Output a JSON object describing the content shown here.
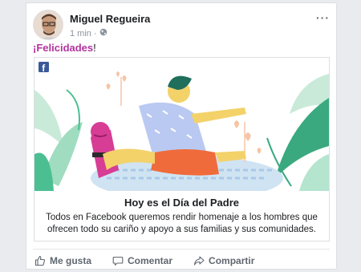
{
  "post": {
    "author": "Miguel Regueira",
    "time": "1 min",
    "separator": "·",
    "more": "···",
    "status_text": "¡Felicidades",
    "status_punct": "!"
  },
  "attachment": {
    "title": "Hoy es el Día del Padre",
    "description": "Todos en Facebook queremos rendir homenaje a los hombres que ofrecen todo su cariño y apoyo a sus familias y sus comunidades.",
    "brand_letter": "f"
  },
  "actions": {
    "like": "Me gusta",
    "comment": "Comentar",
    "share": "Compartir"
  },
  "colors": {
    "status": "#b3339e",
    "facebook_blue": "#3b5998",
    "action_gray": "#606770"
  },
  "icons": [
    "globe-icon",
    "like-icon",
    "comment-icon",
    "share-icon",
    "facebook-logo-icon",
    "more-icon"
  ]
}
